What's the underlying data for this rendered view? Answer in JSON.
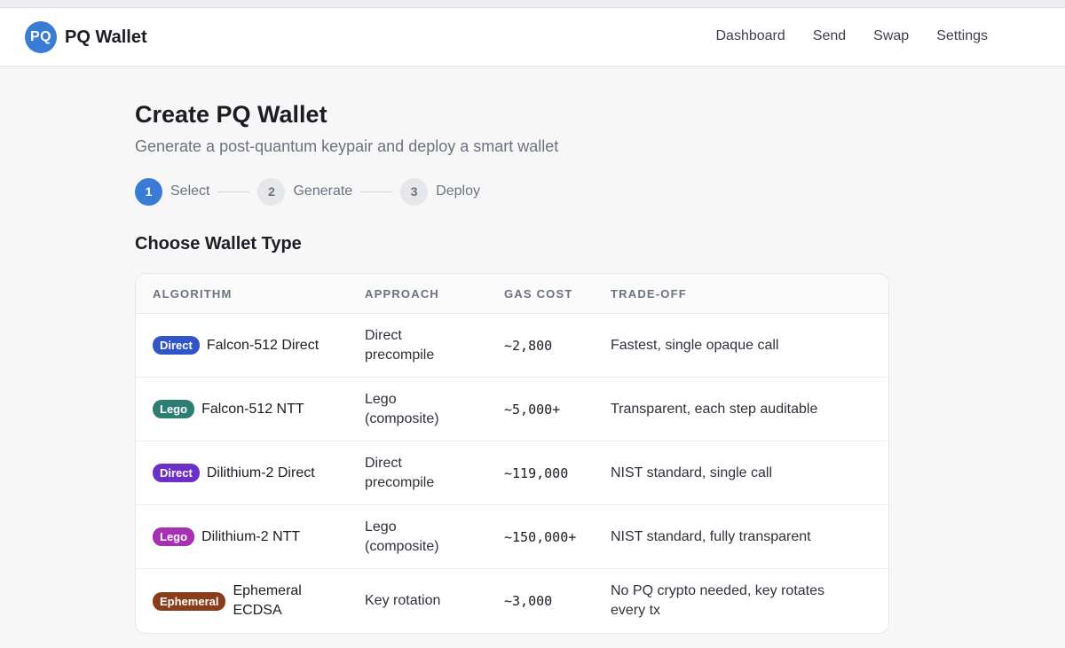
{
  "app": {
    "logo_text": "PQ",
    "name": "PQ Wallet"
  },
  "nav": [
    {
      "label": "Dashboard"
    },
    {
      "label": "Send"
    },
    {
      "label": "Swap"
    },
    {
      "label": "Settings"
    }
  ],
  "page": {
    "title": "Create PQ Wallet",
    "subtitle": "Generate a post-quantum keypair and deploy a smart wallet"
  },
  "steps": [
    {
      "number": "1",
      "label": "Select",
      "active": true
    },
    {
      "number": "2",
      "label": "Generate",
      "active": false
    },
    {
      "number": "3",
      "label": "Deploy",
      "active": false
    }
  ],
  "section_title": "Choose Wallet Type",
  "table": {
    "headers": {
      "algorithm": "Algorithm",
      "approach": "Approach",
      "gas_cost": "Gas Cost",
      "tradeoff": "Trade-off"
    },
    "rows": [
      {
        "badge": "Direct",
        "badge_color": "#2f55c9",
        "name": "Falcon-512 Direct",
        "approach_line1": "Direct",
        "approach_line2": "precompile",
        "gas": "~2,800",
        "tradeoff": "Fastest, single opaque call"
      },
      {
        "badge": "Lego",
        "badge_color": "#2e7d73",
        "name": "Falcon-512 NTT",
        "approach_line1": "Lego",
        "approach_line2": "(composite)",
        "gas": "~5,000+",
        "tradeoff": "Transparent, each step auditable"
      },
      {
        "badge": "Direct",
        "badge_color": "#6d2fc9",
        "name": "Dilithium-2 Direct",
        "approach_line1": "Direct",
        "approach_line2": "precompile",
        "gas": "~119,000",
        "tradeoff": "NIST standard, single call"
      },
      {
        "badge": "Lego",
        "badge_color": "#a62fb3",
        "name": "Dilithium-2 NTT",
        "approach_line1": "Lego",
        "approach_line2": "(composite)",
        "gas": "~150,000+",
        "tradeoff": "NIST standard, fully transparent"
      },
      {
        "badge": "Ephemeral",
        "badge_color": "#8a3d1a",
        "name_line1": "Ephemeral",
        "name_line2": "ECDSA",
        "approach": "Key rotation",
        "gas": "~3,000",
        "tradeoff_line1": "No PQ crypto needed, key rotates",
        "tradeoff_line2": "every tx"
      }
    ]
  }
}
